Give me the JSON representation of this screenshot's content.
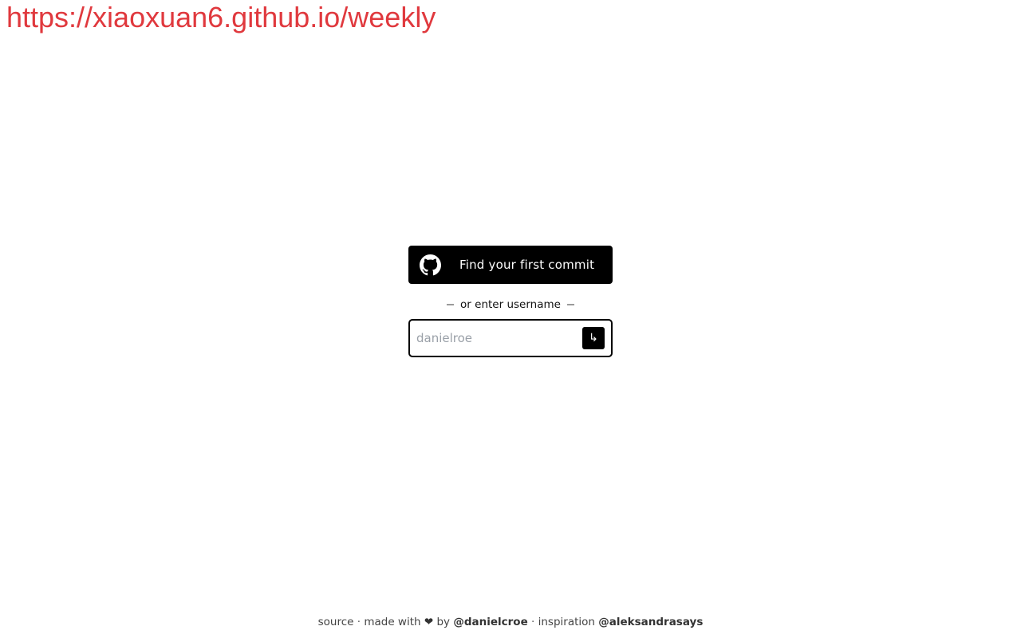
{
  "watermark": {
    "url": "https://xiaoxuan6.github.io/weekly"
  },
  "main": {
    "github_button": {
      "label": "Find your first commit",
      "icon": "github-icon"
    },
    "divider_text": "or enter username",
    "username_input": {
      "placeholder": "danielroe",
      "value": ""
    },
    "submit_button": {
      "icon": "return-arrow-icon",
      "glyph": "↳"
    }
  },
  "footer": {
    "source": "source",
    "sep1": " · ",
    "made_with": "made with ",
    "heart": "❤",
    "by": " by ",
    "author": "@danielcroe",
    "sep2": " · ",
    "inspiration": "inspiration ",
    "inspiration_handle": "@aleksandrasays"
  },
  "colors": {
    "watermark": "#e0393e",
    "button_bg": "#000000",
    "placeholder": "#9aa0a8"
  }
}
